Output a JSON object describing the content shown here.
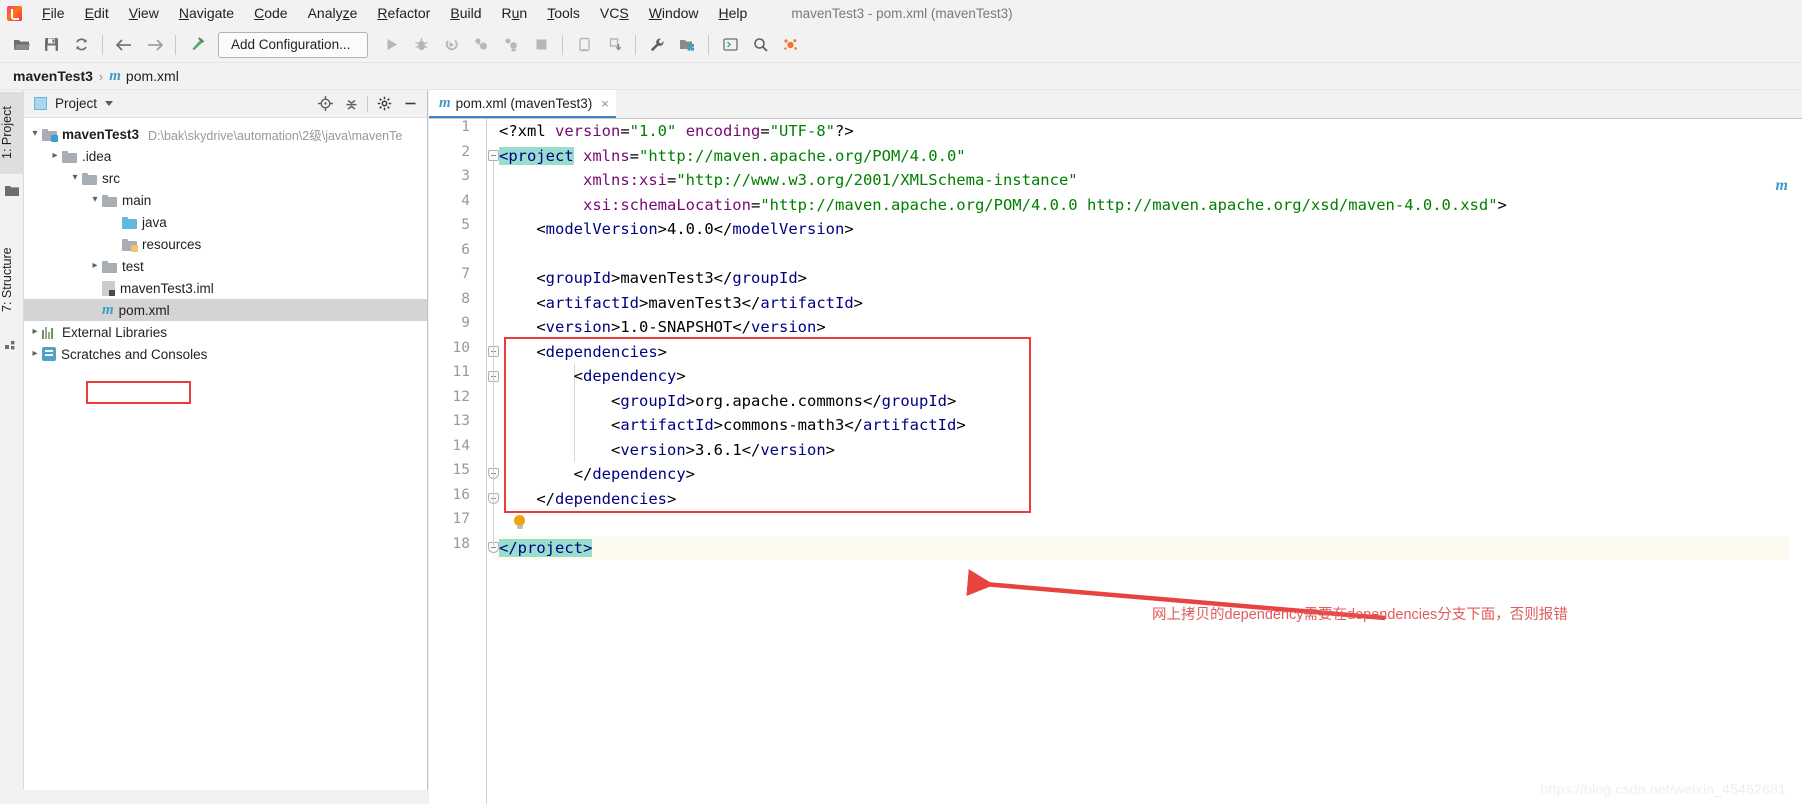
{
  "window": {
    "title": "mavenTest3 - pom.xml (mavenTest3)",
    "accent": "#4083c9",
    "annotation_color": "#ee3b38"
  },
  "menu": {
    "items": [
      {
        "label": "File",
        "mnemonic": "F"
      },
      {
        "label": "Edit",
        "mnemonic": "E"
      },
      {
        "label": "View",
        "mnemonic": "V"
      },
      {
        "label": "Navigate",
        "mnemonic": "N"
      },
      {
        "label": "Code",
        "mnemonic": "C"
      },
      {
        "label": "Analyze",
        "mnemonic": "z"
      },
      {
        "label": "Refactor",
        "mnemonic": "R"
      },
      {
        "label": "Build",
        "mnemonic": "B"
      },
      {
        "label": "Run",
        "mnemonic": "u"
      },
      {
        "label": "Tools",
        "mnemonic": "T"
      },
      {
        "label": "VCS",
        "mnemonic": "S"
      },
      {
        "label": "Window",
        "mnemonic": "W"
      },
      {
        "label": "Help",
        "mnemonic": "H"
      }
    ]
  },
  "toolbar": {
    "add_configuration_label": "Add Configuration...",
    "icons": [
      "open-folder-icon",
      "save-all-icon",
      "sync-refresh-icon",
      "back-arrow-icon",
      "forward-arrow-icon",
      "build-hammer-icon",
      "run-icon",
      "debug-icon",
      "run-with-coverage-icon",
      "profile-icon",
      "profile-memory-icon",
      "stop-icon",
      "device-manager-icon",
      "sync-project-icon",
      "settings-wrench-icon",
      "project-structure-icon",
      "terminal-icon",
      "search-everywhere-icon",
      "ide-assistant-icon"
    ]
  },
  "breadcrumb": {
    "project": "mavenTest3",
    "separator": "›",
    "file": "pom.xml",
    "file_icon": "maven-m-icon"
  },
  "tool_stripe": {
    "project_button": "1: Project",
    "structure_button": "7: Structure"
  },
  "project_panel": {
    "title": "Project",
    "actions": [
      "locate-target-icon",
      "collapse-all-icon",
      "settings-gear-icon",
      "hide-panel-icon"
    ],
    "tree": [
      {
        "label": "mavenTest3",
        "path": "D:\\bak\\skydrive\\automation\\2级\\java\\mavenTe",
        "depth": 0,
        "arrow": "expanded",
        "icon": "module-folder-icon",
        "bold": true,
        "selected": false
      },
      {
        "label": ".idea",
        "path": "",
        "depth": 1,
        "arrow": "collapsed",
        "icon": "folder-icon",
        "bold": false,
        "selected": false
      },
      {
        "label": "src",
        "path": "",
        "depth": 1,
        "arrow": "expanded",
        "icon": "folder-icon",
        "bold": false,
        "selected": false
      },
      {
        "label": "main",
        "path": "",
        "depth": 2,
        "arrow": "expanded",
        "icon": "folder-icon",
        "bold": false,
        "selected": false
      },
      {
        "label": "java",
        "path": "",
        "depth": 3,
        "arrow": "none",
        "icon": "sources-root-folder-icon",
        "bold": false,
        "selected": false
      },
      {
        "label": "resources",
        "path": "",
        "depth": 3,
        "arrow": "none",
        "icon": "resources-root-folder-icon",
        "bold": false,
        "selected": false
      },
      {
        "label": "test",
        "path": "",
        "depth": 2,
        "arrow": "collapsed",
        "icon": "folder-icon",
        "bold": false,
        "selected": false
      },
      {
        "label": "mavenTest3.iml",
        "path": "",
        "depth": 2,
        "arrow": "none",
        "icon": "iml-file-icon",
        "bold": false,
        "selected": false
      },
      {
        "label": "pom.xml",
        "path": "",
        "depth": 2,
        "arrow": "none",
        "icon": "maven-m-icon",
        "bold": false,
        "selected": true
      },
      {
        "label": "External Libraries",
        "path": "",
        "depth": 0,
        "arrow": "collapsed",
        "icon": "libraries-icon",
        "bold": false,
        "selected": false
      },
      {
        "label": "Scratches and Consoles",
        "path": "",
        "depth": 0,
        "arrow": "collapsed",
        "icon": "scratches-icon",
        "bold": false,
        "selected": false
      }
    ]
  },
  "editor": {
    "tab": {
      "label": "pom.xml (mavenTest3)",
      "icon": "maven-m-icon",
      "close": "×"
    },
    "caret_line": 18,
    "line_numbers": [
      1,
      2,
      3,
      4,
      5,
      6,
      7,
      8,
      9,
      10,
      11,
      12,
      13,
      14,
      15,
      16,
      17,
      18
    ],
    "code_lines": [
      {
        "n": 1,
        "segments": [
          {
            "t": "<?xml ",
            "c": "punct"
          },
          {
            "t": "version",
            "c": "attr"
          },
          {
            "t": "=",
            "c": "punct"
          },
          {
            "t": "\"1.0\"",
            "c": "str"
          },
          {
            "t": " ",
            "c": "punct"
          },
          {
            "t": "encoding",
            "c": "attr"
          },
          {
            "t": "=",
            "c": "punct"
          },
          {
            "t": "\"UTF-8\"",
            "c": "str"
          },
          {
            "t": "?>",
            "c": "punct"
          }
        ]
      },
      {
        "n": 2,
        "segments": [
          {
            "t": "<project",
            "c": "tag-hl"
          },
          {
            "t": " ",
            "c": "punct"
          },
          {
            "t": "xmlns",
            "c": "attr"
          },
          {
            "t": "=",
            "c": "punct"
          },
          {
            "t": "\"http://maven.apache.org/POM/4.0.0\"",
            "c": "str"
          }
        ]
      },
      {
        "n": 3,
        "segments": [
          {
            "t": "         ",
            "c": "punct"
          },
          {
            "t": "xmlns:xsi",
            "c": "attr"
          },
          {
            "t": "=",
            "c": "punct"
          },
          {
            "t": "\"http://www.w3.org/2001/XMLSchema-instance\"",
            "c": "str"
          }
        ]
      },
      {
        "n": 4,
        "segments": [
          {
            "t": "         ",
            "c": "punct"
          },
          {
            "t": "xsi:schemaLocation",
            "c": "attr"
          },
          {
            "t": "=",
            "c": "punct"
          },
          {
            "t": "\"http://maven.apache.org/POM/4.0.0 http://maven.apache.org/xsd/maven-4.0.0.xsd\">",
            "c": "str"
          }
        ]
      },
      {
        "n": 5,
        "segments": [
          {
            "t": "    <",
            "c": "punct"
          },
          {
            "t": "modelVersion",
            "c": "tag"
          },
          {
            "t": ">",
            "c": "punct"
          },
          {
            "t": "4.0.0",
            "c": "txt"
          },
          {
            "t": "</",
            "c": "punct"
          },
          {
            "t": "modelVersion",
            "c": "tag"
          },
          {
            "t": ">",
            "c": "punct"
          }
        ]
      },
      {
        "n": 6,
        "segments": []
      },
      {
        "n": 7,
        "segments": [
          {
            "t": "    <",
            "c": "punct"
          },
          {
            "t": "groupId",
            "c": "tag"
          },
          {
            "t": ">",
            "c": "punct"
          },
          {
            "t": "mavenTest3",
            "c": "txt"
          },
          {
            "t": "</",
            "c": "punct"
          },
          {
            "t": "groupId",
            "c": "tag"
          },
          {
            "t": ">",
            "c": "punct"
          }
        ]
      },
      {
        "n": 8,
        "segments": [
          {
            "t": "    <",
            "c": "punct"
          },
          {
            "t": "artifactId",
            "c": "tag"
          },
          {
            "t": ">",
            "c": "punct"
          },
          {
            "t": "mavenTest3",
            "c": "txt"
          },
          {
            "t": "</",
            "c": "punct"
          },
          {
            "t": "artifactId",
            "c": "tag"
          },
          {
            "t": ">",
            "c": "punct"
          }
        ]
      },
      {
        "n": 9,
        "segments": [
          {
            "t": "    <",
            "c": "punct"
          },
          {
            "t": "version",
            "c": "tag"
          },
          {
            "t": ">",
            "c": "punct"
          },
          {
            "t": "1.0-SNAPSHOT",
            "c": "txt"
          },
          {
            "t": "</",
            "c": "punct"
          },
          {
            "t": "version",
            "c": "tag"
          },
          {
            "t": ">",
            "c": "punct"
          }
        ]
      },
      {
        "n": 10,
        "segments": [
          {
            "t": "    <",
            "c": "punct"
          },
          {
            "t": "dependencies",
            "c": "tag"
          },
          {
            "t": ">",
            "c": "punct"
          }
        ]
      },
      {
        "n": 11,
        "segments": [
          {
            "t": "        <",
            "c": "punct"
          },
          {
            "t": "dependency",
            "c": "tag"
          },
          {
            "t": ">",
            "c": "punct"
          }
        ]
      },
      {
        "n": 12,
        "segments": [
          {
            "t": "            <",
            "c": "punct"
          },
          {
            "t": "groupId",
            "c": "tag"
          },
          {
            "t": ">",
            "c": "punct"
          },
          {
            "t": "org.apache.commons",
            "c": "txt"
          },
          {
            "t": "</",
            "c": "punct"
          },
          {
            "t": "groupId",
            "c": "tag"
          },
          {
            "t": ">",
            "c": "punct"
          }
        ]
      },
      {
        "n": 13,
        "segments": [
          {
            "t": "            <",
            "c": "punct"
          },
          {
            "t": "artifactId",
            "c": "tag"
          },
          {
            "t": ">",
            "c": "punct"
          },
          {
            "t": "commons-math3",
            "c": "txt"
          },
          {
            "t": "</",
            "c": "punct"
          },
          {
            "t": "artifactId",
            "c": "tag"
          },
          {
            "t": ">",
            "c": "punct"
          }
        ]
      },
      {
        "n": 14,
        "segments": [
          {
            "t": "            <",
            "c": "punct"
          },
          {
            "t": "version",
            "c": "tag"
          },
          {
            "t": ">",
            "c": "punct"
          },
          {
            "t": "3.6.1",
            "c": "txt"
          },
          {
            "t": "</",
            "c": "punct"
          },
          {
            "t": "version",
            "c": "tag"
          },
          {
            "t": ">",
            "c": "punct"
          }
        ]
      },
      {
        "n": 15,
        "segments": [
          {
            "t": "        </",
            "c": "punct"
          },
          {
            "t": "dependency",
            "c": "tag"
          },
          {
            "t": ">",
            "c": "punct"
          }
        ]
      },
      {
        "n": 16,
        "segments": [
          {
            "t": "    </",
            "c": "punct"
          },
          {
            "t": "dependencies",
            "c": "tag"
          },
          {
            "t": ">",
            "c": "punct"
          }
        ]
      },
      {
        "n": 17,
        "segments": []
      },
      {
        "n": 18,
        "segments": [
          {
            "t": "</project>",
            "c": "tag-hl"
          }
        ]
      }
    ],
    "intention_bulb": "lightbulb-icon",
    "right_marker": "maven-m-icon"
  },
  "annotation": {
    "text": "网上拷贝的dependency需要在dependencies分支下面，否则报错",
    "arrow": "red-arrow-icon",
    "box_label": "dependencies-highlight-box"
  },
  "watermark": {
    "text": "https://blog.csdn.net/weixin_45462681"
  }
}
